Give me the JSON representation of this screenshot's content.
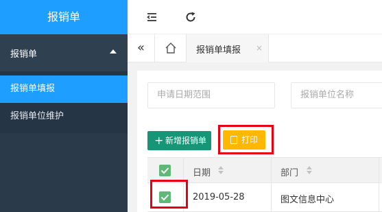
{
  "sidebar": {
    "title": "报销单",
    "group_label": "报销单",
    "items": [
      {
        "label": "报销单填报",
        "active": true
      },
      {
        "label": "报销单位维护",
        "active": false
      }
    ]
  },
  "topbar": {
    "icons": [
      "collapse-menu-icon",
      "refresh-icon"
    ]
  },
  "tabs": {
    "back_icon": "«",
    "home_icon": "home-icon",
    "active_label": "报销单填报",
    "close_icon": "×"
  },
  "search": {
    "date_placeholder": "申请日期范围",
    "unit_placeholder": "报销单位名称"
  },
  "toolbar": {
    "add_label": "新增报销单",
    "add_icon": "+",
    "print_label": "打印",
    "print_icon": "document-icon"
  },
  "table": {
    "columns": [
      "日期",
      "部门"
    ],
    "rows": [
      {
        "checked": true,
        "date": "2019-05-28",
        "department": "图文信息中心"
      }
    ]
  },
  "colors": {
    "sidebar_bg": "#2f4050",
    "accent_blue": "#1e9fff",
    "add_button": "#159676",
    "print_button": "#ffb800",
    "checkbox": "#5fb878",
    "highlight_red": "#e60012"
  }
}
